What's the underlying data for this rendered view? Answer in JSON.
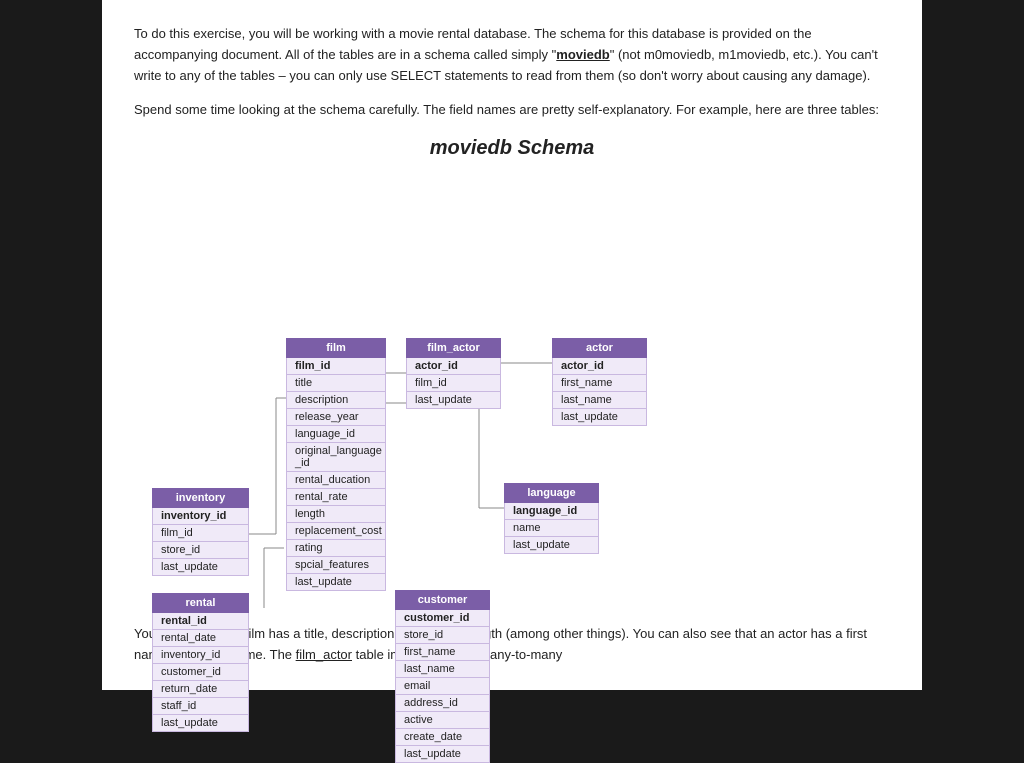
{
  "intro": {
    "paragraph1": "To do this exercise, you will be working with a movie rental database. The schema for this database is provided on the accompanying document. All of the tables are in a schema called simply \"moviedb\" (not m0moviedb, m1moviedb, etc.). You can't write to any of the tables – you can only use SELECT statements to read from them (so don't worry about causing any damage).",
    "paragraph2": "Spend some time looking at the schema carefully. The field names are pretty self-explanatory. For example, here are three tables:"
  },
  "schema_title": "moviedb Schema",
  "tables": {
    "film": {
      "header": "film",
      "rows": [
        "film_id",
        "title",
        "description",
        "release_year",
        "language_id",
        "original_language_id",
        "rental_ducation",
        "rental_rate",
        "length",
        "replacement_cost",
        "rating",
        "spcial_features",
        "last_update"
      ]
    },
    "film_actor": {
      "header": "film_actor",
      "rows": [
        "actor_id",
        "film_id",
        "last_update"
      ]
    },
    "actor": {
      "header": "actor",
      "rows": [
        "actor_id",
        "first_name",
        "last_name",
        "last_update"
      ]
    },
    "language": {
      "header": "language",
      "rows": [
        "language_id",
        "name",
        "last_update"
      ]
    },
    "inventory": {
      "header": "inventory",
      "rows": [
        "inventory_id",
        "film_id",
        "store_id",
        "last_update"
      ]
    },
    "rental": {
      "header": "rental",
      "rows": [
        "rental_id",
        "rental_date",
        "inventory_id",
        "customer_id",
        "return_date",
        "staff_id",
        "last_update"
      ]
    },
    "customer": {
      "header": "customer",
      "rows": [
        "customer_id",
        "store_id",
        "first_name",
        "last_name",
        "email",
        "address_id",
        "active",
        "create_date",
        "last_update"
      ]
    }
  },
  "bottom_text": {
    "paragraph1": "You can see that a film has a title, description, rating, and length (among other things). You can also see that an actor has a first name and a last name. The film_actor table implements the many-to-many"
  }
}
